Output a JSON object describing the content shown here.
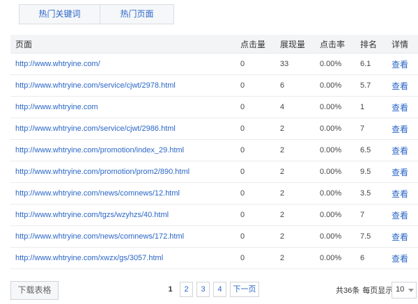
{
  "tabs": [
    {
      "label": "热门关键词"
    },
    {
      "label": "热门页面"
    }
  ],
  "table": {
    "headers": {
      "page": "页面",
      "clicks": "点击量",
      "impressions": "展现量",
      "ctr": "点击率",
      "rank": "排名",
      "detail": "详情"
    },
    "rows": [
      {
        "url": "http://www.whtryine.com/",
        "clicks": "0",
        "impressions": "33",
        "ctr": "0.00%",
        "rank": "6.1",
        "detail": "查看"
      },
      {
        "url": "http://www.whtryine.com/service/cjwt/2978.html",
        "clicks": "0",
        "impressions": "6",
        "ctr": "0.00%",
        "rank": "5.7",
        "detail": "查看"
      },
      {
        "url": "http://www.whtryine.com",
        "clicks": "0",
        "impressions": "4",
        "ctr": "0.00%",
        "rank": "1",
        "detail": "查看"
      },
      {
        "url": "http://www.whtryine.com/service/cjwt/2986.html",
        "clicks": "0",
        "impressions": "2",
        "ctr": "0.00%",
        "rank": "7",
        "detail": "查看"
      },
      {
        "url": "http://www.whtryine.com/promotion/index_29.html",
        "clicks": "0",
        "impressions": "2",
        "ctr": "0.00%",
        "rank": "6.5",
        "detail": "查看"
      },
      {
        "url": "http://www.whtryine.com/promotion/prom2/890.html",
        "clicks": "0",
        "impressions": "2",
        "ctr": "0.00%",
        "rank": "9.5",
        "detail": "查看"
      },
      {
        "url": "http://www.whtryine.com/news/comnews/12.html",
        "clicks": "0",
        "impressions": "2",
        "ctr": "0.00%",
        "rank": "3.5",
        "detail": "查看"
      },
      {
        "url": "http://www.whtryine.com/tgzs/wzyhzs/40.html",
        "clicks": "0",
        "impressions": "2",
        "ctr": "0.00%",
        "rank": "7",
        "detail": "查看"
      },
      {
        "url": "http://www.whtryine.com/news/comnews/172.html",
        "clicks": "0",
        "impressions": "2",
        "ctr": "0.00%",
        "rank": "7.5",
        "detail": "查看"
      },
      {
        "url": "http://www.whtryine.com/xwzx/gs/3057.html",
        "clicks": "0",
        "impressions": "2",
        "ctr": "0.00%",
        "rank": "6",
        "detail": "查看"
      }
    ]
  },
  "footer": {
    "download_label": "下载表格",
    "pagination": {
      "current": "1",
      "pages": [
        "2",
        "3",
        "4"
      ],
      "next_label": "下一页"
    },
    "total_label": "共36条",
    "per_page_label": "每页显示:",
    "per_page_value": "10"
  },
  "colors": {
    "link": "#2a66c7",
    "header_bg": "#f3f4f6",
    "border": "#e9ebee"
  }
}
